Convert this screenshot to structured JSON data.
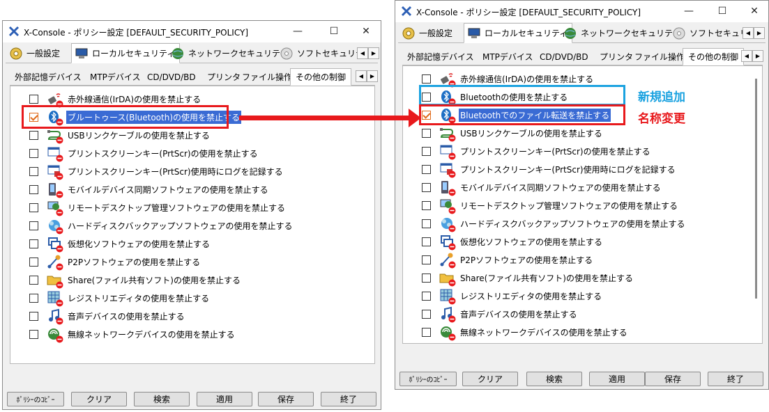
{
  "window_title": "X-Console - ポリシー設定 [DEFAULT_SECURITY_POLICY]",
  "window_controls": {
    "minimize": "—",
    "maximize": "☐",
    "close": "✕"
  },
  "main_tabs": [
    "一般設定",
    "ローカルセキュリティ",
    "ネットワークセキュリティ",
    "ソフトセキュリティ"
  ],
  "sub_tabs": [
    "外部記憶デバイス",
    "MTPデバイス",
    "CD/DVD/BD",
    "プリンタ",
    "ファイル操作",
    "その他の制御"
  ],
  "scroll_arrows": {
    "left": "◀",
    "right": "▶"
  },
  "left_items": [
    {
      "label": "赤外線通信(IrDA)の使用を禁止する",
      "icon": "infrared-icon",
      "checked": false
    },
    {
      "label": "ブルートゥース(Bluetooth)の使用を禁止する",
      "icon": "bluetooth-icon",
      "checked": true,
      "selected": true
    },
    {
      "label": "USBリンクケーブルの使用を禁止する",
      "icon": "usb-cable-icon",
      "checked": false
    },
    {
      "label": "プリントスクリーンキー(PrtScr)の使用を禁止する",
      "icon": "printscreen-icon",
      "checked": false
    },
    {
      "label": "プリントスクリーンキー(PrtScr)使用時にログを記録する",
      "icon": "printscreen-log-icon",
      "checked": false
    },
    {
      "label": "モバイルデバイス同期ソフトウェアの使用を禁止する",
      "icon": "mobile-sync-icon",
      "checked": false
    },
    {
      "label": "リモートデスクトップ管理ソフトウェアの使用を禁止する",
      "icon": "remote-desktop-icon",
      "checked": false
    },
    {
      "label": "ハードディスクバックアップソフトウェアの使用を禁止する",
      "icon": "backup-icon",
      "checked": false
    },
    {
      "label": "仮想化ソフトウェアの使用を禁止する",
      "icon": "virtualization-icon",
      "checked": false
    },
    {
      "label": "P2Pソフトウェアの使用を禁止する",
      "icon": "p2p-icon",
      "checked": false
    },
    {
      "label": "Share(ファイル共有ソフト)の使用を禁止する",
      "icon": "share-folder-icon",
      "checked": false
    },
    {
      "label": "レジストリエディタの使用を禁止する",
      "icon": "registry-icon",
      "checked": false
    },
    {
      "label": "音声デバイスの使用を禁止する",
      "icon": "audio-icon",
      "checked": false
    },
    {
      "label": "無線ネットワークデバイスの使用を禁止する",
      "icon": "wireless-icon",
      "checked": false
    }
  ],
  "right_items": [
    {
      "label": "赤外線通信(IrDA)の使用を禁止する",
      "icon": "infrared-icon",
      "checked": false
    },
    {
      "label": "Bluetoothの使用を禁止する",
      "icon": "bluetooth-icon",
      "checked": false
    },
    {
      "label": "Bluetoothでのファイル転送を禁止する",
      "icon": "bluetooth-icon",
      "checked": true,
      "selected": true
    },
    {
      "label": "USBリンクケーブルの使用を禁止する",
      "icon": "usb-cable-icon",
      "checked": false
    },
    {
      "label": "プリントスクリーンキー(PrtScr)の使用を禁止する",
      "icon": "printscreen-icon",
      "checked": false
    },
    {
      "label": "プリントスクリーンキー(PrtScr)使用時にログを記録する",
      "icon": "printscreen-log-icon",
      "checked": false
    },
    {
      "label": "モバイルデバイス同期ソフトウェアの使用を禁止する",
      "icon": "mobile-sync-icon",
      "checked": false
    },
    {
      "label": "リモートデスクトップ管理ソフトウェアの使用を禁止する",
      "icon": "remote-desktop-icon",
      "checked": false
    },
    {
      "label": "ハードディスクバックアップソフトウェアの使用を禁止する",
      "icon": "backup-icon",
      "checked": false
    },
    {
      "label": "仮想化ソフトウェアの使用を禁止する",
      "icon": "virtualization-icon",
      "checked": false
    },
    {
      "label": "P2Pソフトウェアの使用を禁止する",
      "icon": "p2p-icon",
      "checked": false
    },
    {
      "label": "Share(ファイル共有ソフト)の使用を禁止する",
      "icon": "share-folder-icon",
      "checked": false
    },
    {
      "label": "レジストリエディタの使用を禁止する",
      "icon": "registry-icon",
      "checked": false
    },
    {
      "label": "音声デバイスの使用を禁止する",
      "icon": "audio-icon",
      "checked": false
    },
    {
      "label": "無線ネットワークデバイスの使用を禁止する",
      "icon": "wireless-icon",
      "checked": false
    }
  ],
  "buttons": [
    "ﾎﾟﾘｼｰのｺﾋﾟｰ",
    "クリア",
    "検索",
    "適用",
    "保存",
    "終了"
  ],
  "annotations": {
    "new": "新規追加",
    "renamed": "名称変更"
  },
  "colors": {
    "highlight_red": "#e8191c",
    "highlight_blue": "#1aa2e0",
    "selection": "#3a6bd4",
    "check": "#e06a1a"
  }
}
